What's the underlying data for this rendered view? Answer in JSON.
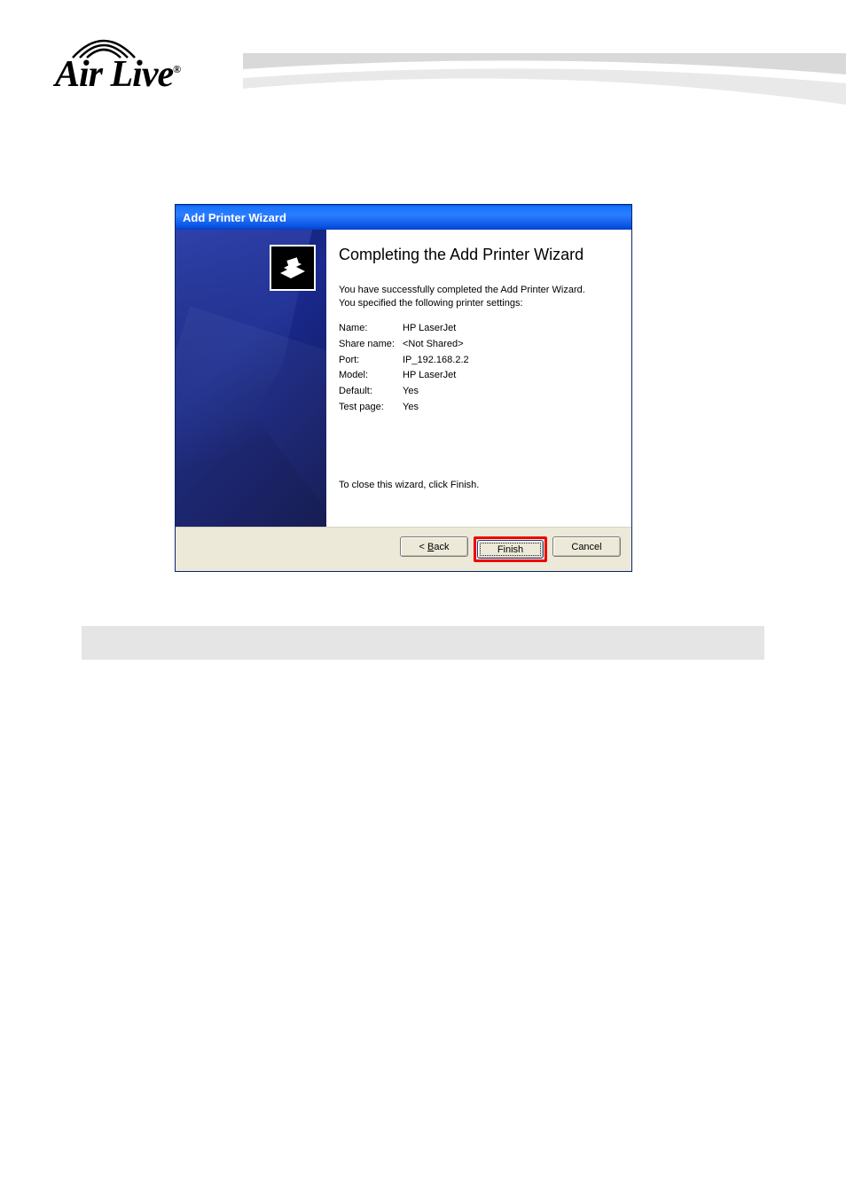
{
  "logo": {
    "brand": "Air Live",
    "reg": "®"
  },
  "dialog": {
    "title": "Add Printer Wizard",
    "heading": "Completing the Add Printer Wizard",
    "intro1": "You have successfully completed the Add Printer Wizard.",
    "intro2": "You specified the following printer settings:",
    "settings": {
      "name_label": "Name:",
      "name_value": "HP LaserJet",
      "share_label": "Share name:",
      "share_value": "<Not Shared>",
      "port_label": "Port:",
      "port_value": "IP_192.168.2.2",
      "model_label": "Model:",
      "model_value": "HP LaserJet",
      "default_label": "Default:",
      "default_value": "Yes",
      "testpage_label": "Test page:",
      "testpage_value": "Yes"
    },
    "close_instruction": "To close this wizard, click Finish.",
    "buttons": {
      "back": "< Back",
      "finish": "Finish",
      "cancel": "Cancel"
    }
  }
}
